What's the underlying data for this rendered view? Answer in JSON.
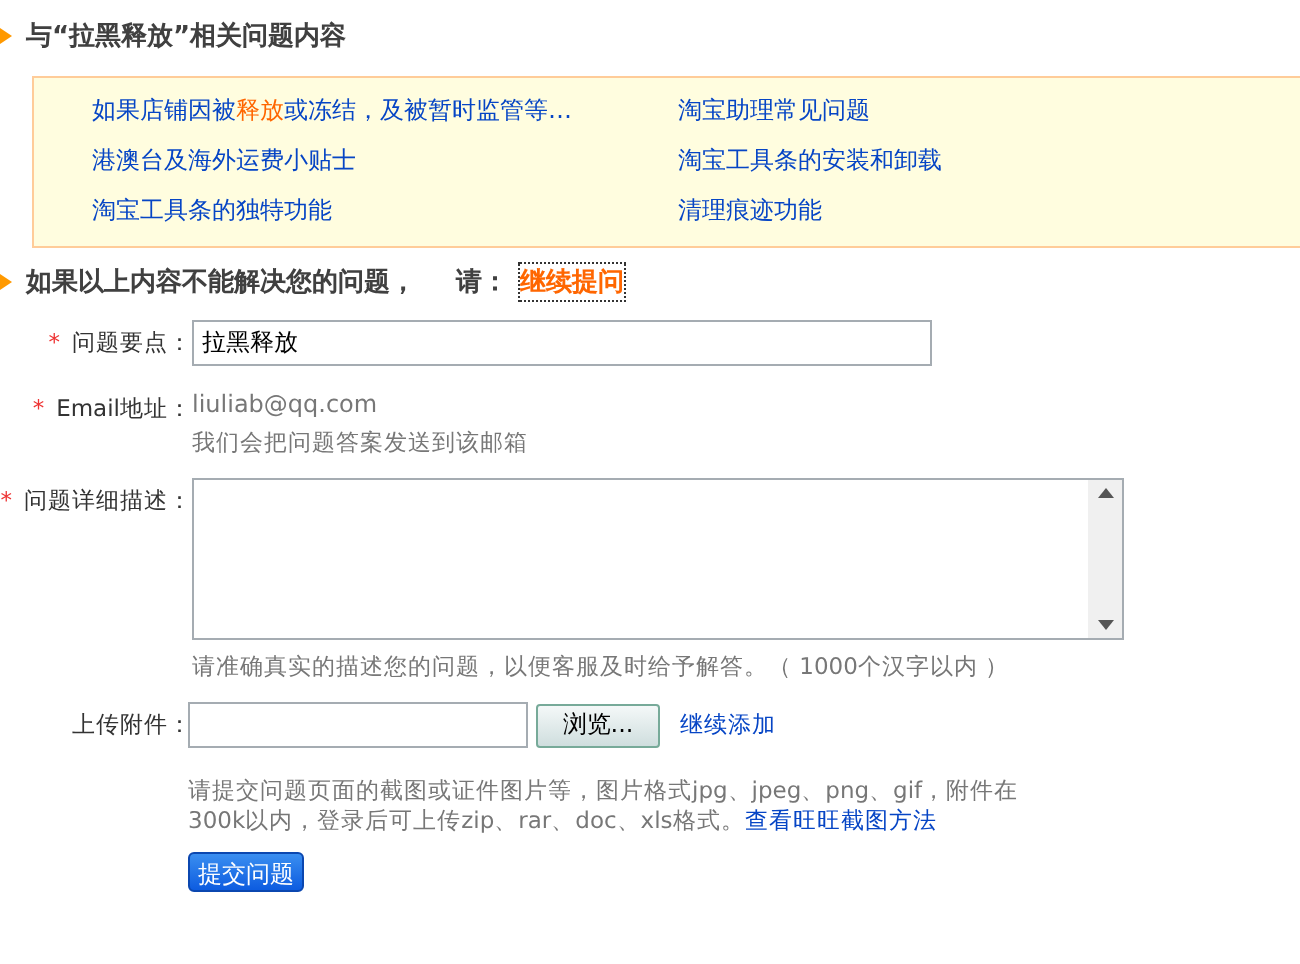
{
  "related_heading": "与“拉黑释放”相关问题内容",
  "related_links": [
    {
      "parts": [
        {
          "text": "如果店铺因被",
          "highlight": false
        },
        {
          "text": "释放",
          "highlight": true
        },
        {
          "text": "或冻结，及被暂时监管等…",
          "highlight": false
        }
      ]
    },
    {
      "parts": [
        {
          "text": "淘宝助理常见问题",
          "highlight": false
        }
      ]
    },
    {
      "parts": [
        {
          "text": "港澳台及海外运费小贴士",
          "highlight": false
        }
      ]
    },
    {
      "parts": [
        {
          "text": "淘宝工具条的安装和卸载",
          "highlight": false
        }
      ]
    },
    {
      "parts": [
        {
          "text": "淘宝工具条的独特功能",
          "highlight": false
        }
      ]
    },
    {
      "parts": [
        {
          "text": "清理痕迹功能",
          "highlight": false
        }
      ]
    }
  ],
  "ask_heading": {
    "text": "如果以上内容不能解决您的问题，",
    "prompt": "请：",
    "link": "继续提问"
  },
  "form": [
    {
      "kind": "input",
      "required": "*",
      "label": "问题要点：",
      "value": "拉黑释放"
    },
    {
      "kind": "static",
      "required": "*",
      "label": "Email地址：",
      "value": "liuliab@qq.com",
      "hint": "我们会把问题答案发送到该邮箱"
    },
    {
      "kind": "textarea",
      "required": "*",
      "label": "问题详细描述：",
      "hint": "请准确真实的描述您的问题，以便客服及时给予解答。（ 1000个汉字以内 ）"
    },
    {
      "kind": "file",
      "label": "上传附件：",
      "button": "浏览...",
      "link": "继续添加",
      "hint": "请提交问题页面的截图或证件图片等，图片格式jpg、jpeg、png、gif，附件在300k以内，登录后可上传zip、rar、doc、xls格式。",
      "hint_link": "查看旺旺截图方法"
    }
  ],
  "submit": "提交问题"
}
